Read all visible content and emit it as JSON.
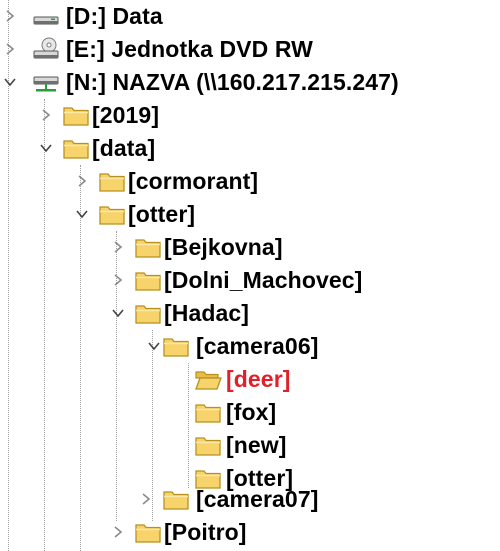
{
  "colors": {
    "text": "#000000",
    "selected_text": "#e0212b",
    "folder_fill": "#f6d36b",
    "folder_border": "#b8901c",
    "chevron": "#8a8a8a",
    "guide_line": "#a0a0a0"
  },
  "tree": {
    "items": [
      {
        "label": "[D:]  Data",
        "icon": "hard-drive-icon",
        "expanded": false,
        "selected": false
      },
      {
        "label": "[E:]  Jednotka DVD RW",
        "icon": "dvd-drive-icon",
        "expanded": false,
        "selected": false
      },
      {
        "label": "[N:]  NAZVA (\\\\160.217.215.247)",
        "icon": "network-drive-icon",
        "expanded": true,
        "selected": false
      },
      {
        "label": "[2019]",
        "icon": "folder-icon",
        "expanded": false,
        "selected": false
      },
      {
        "label": "[data]",
        "icon": "folder-icon",
        "expanded": true,
        "selected": false
      },
      {
        "label": "[cormorant]",
        "icon": "folder-icon",
        "expanded": false,
        "selected": false
      },
      {
        "label": "[otter]",
        "icon": "folder-icon",
        "expanded": true,
        "selected": false
      },
      {
        "label": "[Bejkovna]",
        "icon": "folder-icon",
        "expanded": false,
        "selected": false
      },
      {
        "label": "[Dolni_Machovec]",
        "icon": "folder-icon",
        "expanded": false,
        "selected": false
      },
      {
        "label": "[Hadac]",
        "icon": "folder-icon",
        "expanded": true,
        "selected": false
      },
      {
        "label": "[camera06]",
        "icon": "folder-icon",
        "expanded": true,
        "selected": false
      },
      {
        "label": "[deer]",
        "icon": "folder-open-icon",
        "expanded": false,
        "selected": true
      },
      {
        "label": "[fox]",
        "icon": "folder-icon",
        "expanded": false,
        "selected": false
      },
      {
        "label": "[new]",
        "icon": "folder-icon",
        "expanded": false,
        "selected": false
      },
      {
        "label": "[otter]",
        "icon": "folder-icon",
        "expanded": false,
        "selected": false
      },
      {
        "label": "[camera07]",
        "icon": "folder-icon",
        "expanded": false,
        "selected": false
      },
      {
        "label": "[Poitro]",
        "icon": "folder-icon",
        "expanded": false,
        "selected": false
      }
    ]
  }
}
